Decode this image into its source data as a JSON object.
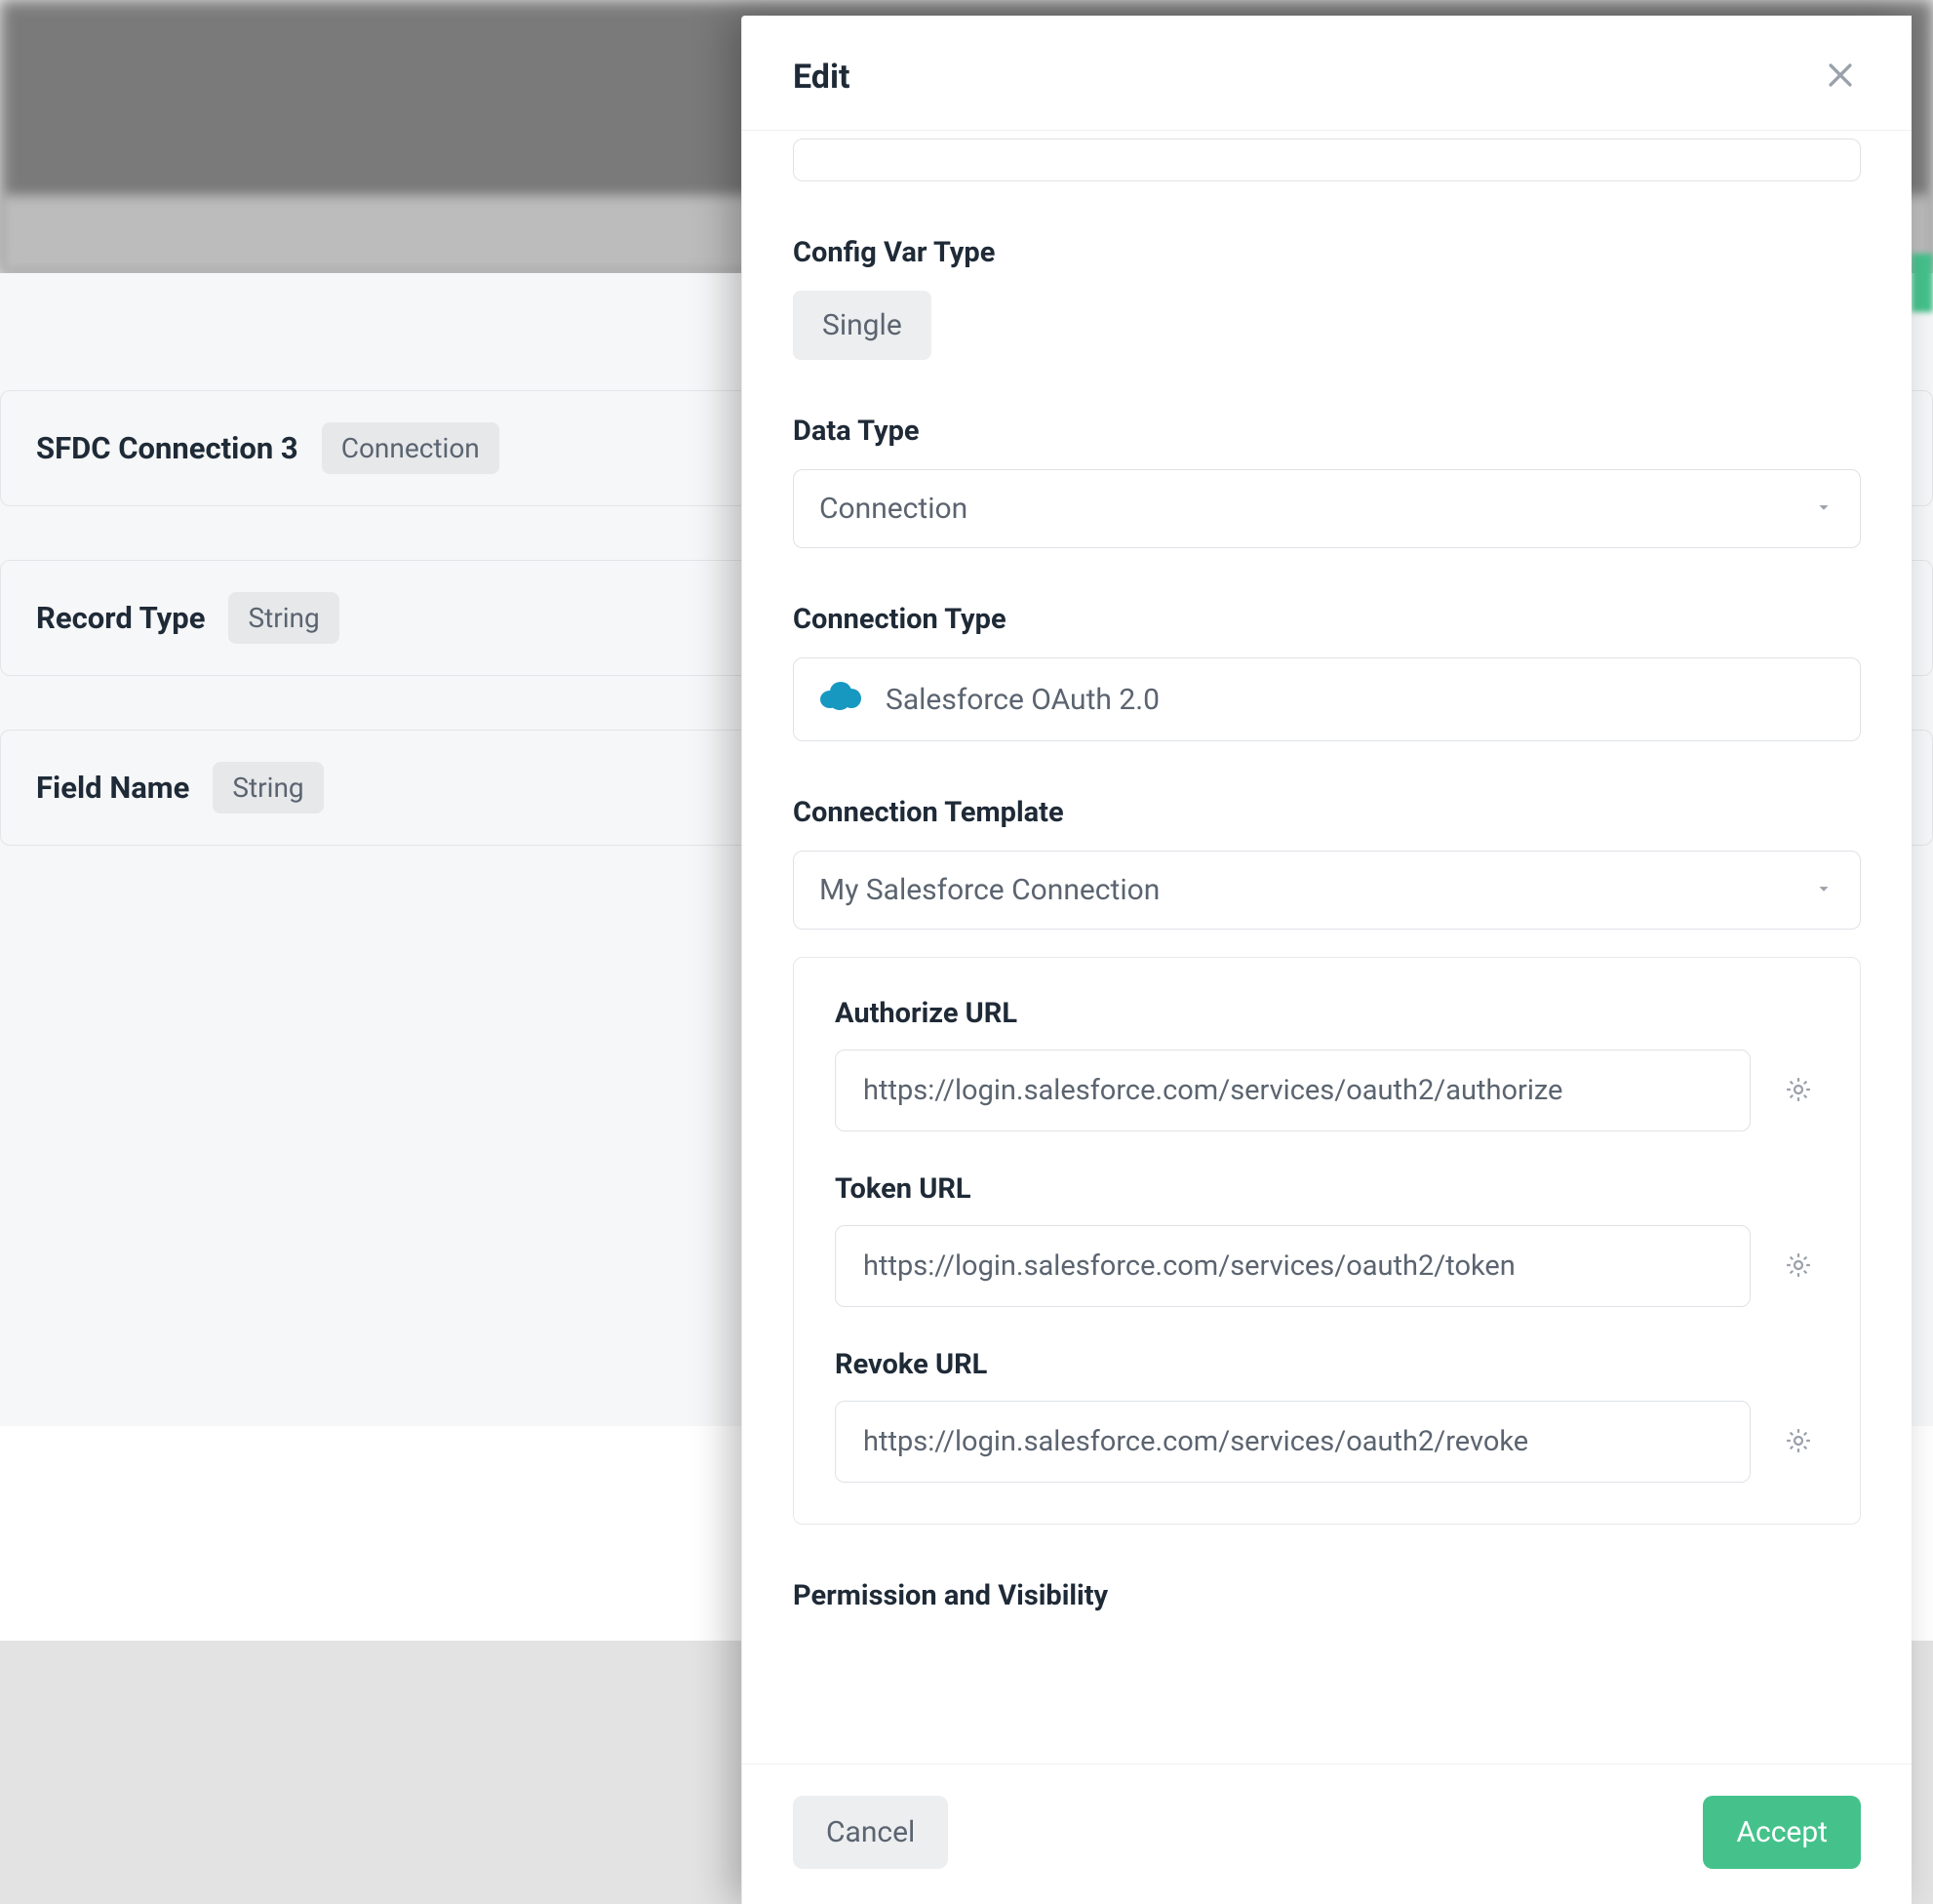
{
  "background": {
    "cards": [
      {
        "title": "SFDC Connection 3",
        "badge": "Connection"
      },
      {
        "title": "Record Type",
        "badge": "String"
      },
      {
        "title": "Field Name",
        "badge": "String"
      }
    ]
  },
  "modal": {
    "title": "Edit",
    "config_var_type": {
      "label": "Config Var Type",
      "value": "Single"
    },
    "data_type": {
      "label": "Data Type",
      "value": "Connection"
    },
    "connection_type": {
      "label": "Connection Type",
      "value": "Salesforce OAuth 2.0"
    },
    "connection_template": {
      "label": "Connection Template",
      "value": "My Salesforce Connection"
    },
    "urls": {
      "authorize": {
        "label": "Authorize URL",
        "value": "https://login.salesforce.com/services/oauth2/authorize"
      },
      "token": {
        "label": "Token URL",
        "value": "https://login.salesforce.com/services/oauth2/token"
      },
      "revoke": {
        "label": "Revoke URL",
        "value": "https://login.salesforce.com/services/oauth2/revoke"
      }
    },
    "permission_heading": "Permission and Visibility",
    "footer": {
      "cancel": "Cancel",
      "accept": "Accept"
    }
  }
}
